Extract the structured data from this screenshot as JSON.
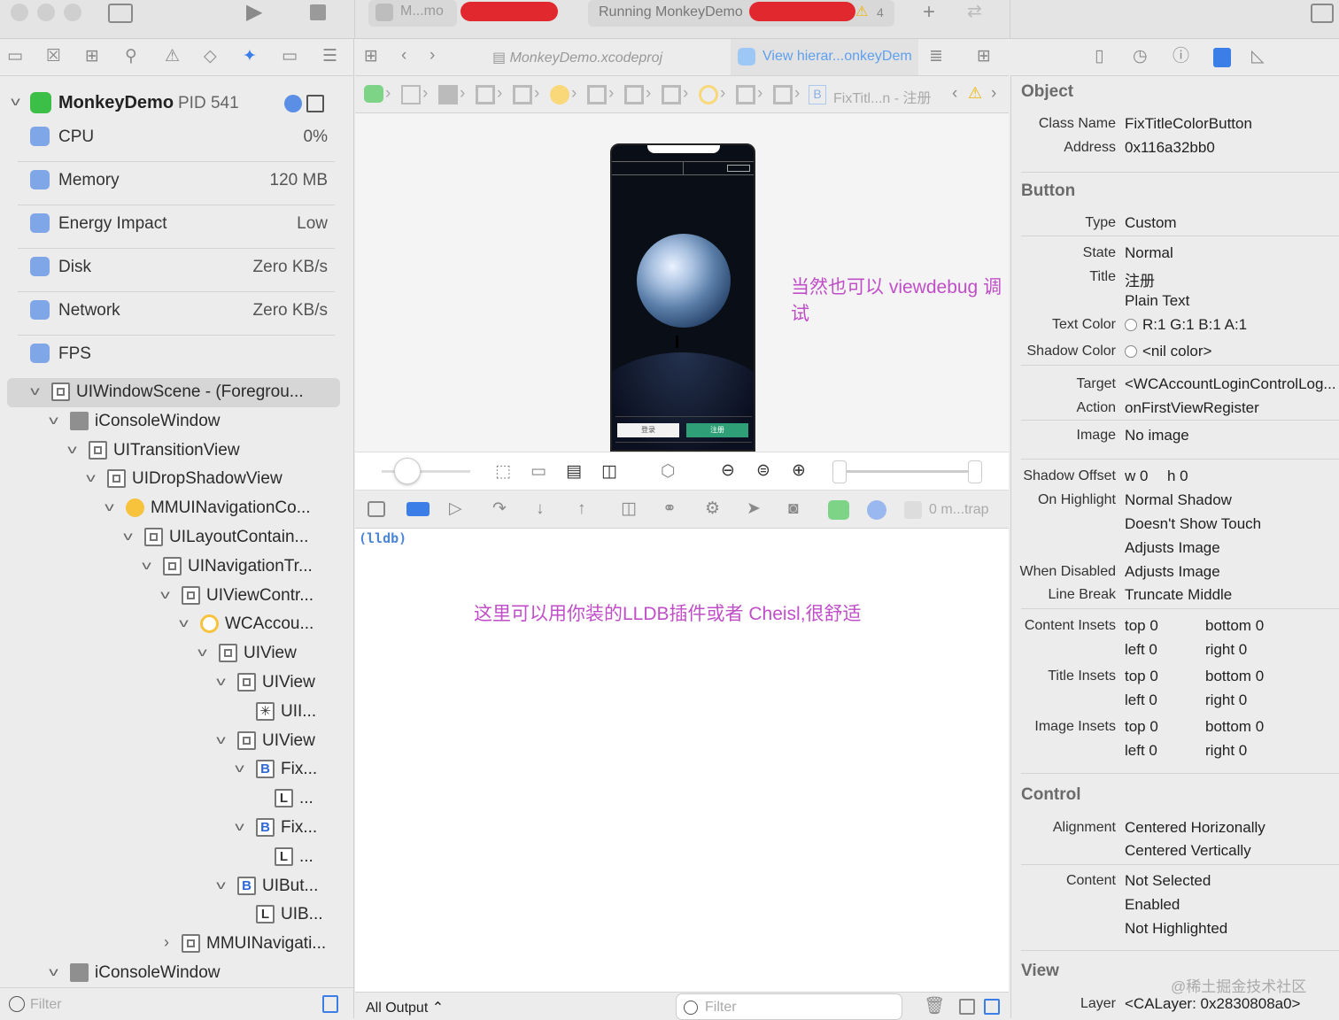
{
  "titlebar": {
    "scheme": "M...mo",
    "status": "Running MonkeyDemo",
    "warnings": "4"
  },
  "editor": {
    "tab1": "MonkeyDemo.xcodeproj",
    "tab2": "View hierar...onkeyDem",
    "jump_last": "FixTitl...n - 注册"
  },
  "debug_nav": {
    "app": {
      "name": "MonkeyDemo",
      "pid": "PID 541"
    },
    "gauges": [
      {
        "name": "CPU",
        "value": "0%",
        "icon": "cpu-icon",
        "color": "#5b8fe6"
      },
      {
        "name": "Memory",
        "value": "120 MB",
        "icon": "memory-icon",
        "color": "#5b8fe6"
      },
      {
        "name": "Energy Impact",
        "value": "Low",
        "icon": "bolt-icon",
        "color": "#5b8fe6"
      },
      {
        "name": "Disk",
        "value": "Zero KB/s",
        "icon": "disk-icon",
        "color": "#5b8fe6"
      },
      {
        "name": "Network",
        "value": "Zero KB/s",
        "icon": "globe-icon",
        "color": "#5b8fe6"
      },
      {
        "name": "FPS",
        "value": "",
        "icon": "fps-icon",
        "color": "#5b8fe6"
      }
    ],
    "tree": [
      {
        "label": "UIWindowScene - (Foregrou...",
        "depth": 0,
        "chev": "v",
        "icon": "inner",
        "selected": true
      },
      {
        "label": "iConsoleWindow",
        "depth": 1,
        "chev": "v",
        "icon": "filled"
      },
      {
        "label": "UITransitionView",
        "depth": 2,
        "chev": "v",
        "icon": "inner"
      },
      {
        "label": "UIDropShadowView",
        "depth": 3,
        "chev": "v",
        "icon": "inner"
      },
      {
        "label": "MMUINavigationCo...",
        "depth": 4,
        "chev": "v",
        "icon": "orng"
      },
      {
        "label": "UILayoutContain...",
        "depth": 5,
        "chev": "v",
        "icon": "inner"
      },
      {
        "label": "UINavigationTr...",
        "depth": 6,
        "chev": "v",
        "icon": "inner"
      },
      {
        "label": "UIViewContr...",
        "depth": 7,
        "chev": "v",
        "icon": "inner"
      },
      {
        "label": "WCAccou...",
        "depth": 8,
        "chev": "v",
        "icon": "orngring"
      },
      {
        "label": "UIView",
        "depth": 9,
        "chev": "v",
        "icon": "inner"
      },
      {
        "label": "UIView",
        "depth": 10,
        "chev": "v",
        "icon": "inner"
      },
      {
        "label": "UII...",
        "depth": 11,
        "chev": "",
        "icon": "img"
      },
      {
        "label": "UIView",
        "depth": 10,
        "chev": "v",
        "icon": "inner"
      },
      {
        "label": "Fix...",
        "depth": 11,
        "chev": "v",
        "icon": "B"
      },
      {
        "label": "...",
        "depth": 12,
        "chev": "",
        "icon": "L"
      },
      {
        "label": "Fix...",
        "depth": 11,
        "chev": "v",
        "icon": "B"
      },
      {
        "label": "...",
        "depth": 12,
        "chev": "",
        "icon": "L"
      },
      {
        "label": "UIBut...",
        "depth": 10,
        "chev": "v",
        "icon": "B"
      },
      {
        "label": "UIB...",
        "depth": 11,
        "chev": "",
        "icon": "L"
      },
      {
        "label": "MMUINavigati...",
        "depth": 7,
        "chev": ">",
        "icon": "inner"
      },
      {
        "label": "iConsoleWindow",
        "depth": 1,
        "chev": "v",
        "icon": "filled"
      }
    ],
    "filter_placeholder": "Filter"
  },
  "canvas": {
    "annotation": "当然也可以 viewdebug 调试",
    "phone_btn_left": "登录",
    "phone_btn_right": "注册"
  },
  "console": {
    "prompt": "(lldb)",
    "annotation": "这里可以用你装的LLDB插件或者 Cheisl,很舒适",
    "output_selector": "All Output ⌃",
    "filter_placeholder": "Filter",
    "stop_label": "0 m...trap"
  },
  "inspector": {
    "object": {
      "title": "Object",
      "class_name_k": "Class Name",
      "class_name": "FixTitleColorButton",
      "address_k": "Address",
      "address": "0x116a32bb0"
    },
    "button": {
      "title": "Button",
      "type_k": "Type",
      "type": "Custom",
      "state_k": "State",
      "state": "Normal",
      "title_k": "Title",
      "title_v": "注册",
      "title_kind": "Plain Text",
      "text_color_k": "Text Color",
      "text_color": "R:1 G:1 B:1 A:1",
      "shadow_color_k": "Shadow Color",
      "shadow_color": "<nil color>",
      "target_k": "Target",
      "target": "<WCAccountLoginControlLog...",
      "action_k": "Action",
      "action": "onFirstViewRegister",
      "image_k": "Image",
      "image": "No image",
      "shadow_offset_k": "Shadow Offset",
      "shadow_w": "w  0",
      "shadow_h": "h  0",
      "on_highlight_k": "On Highlight",
      "on_highlight": "Normal Shadow",
      "touch": "Doesn't Show Touch",
      "adjusts1": "Adjusts Image",
      "when_disabled_k": "When Disabled",
      "adjusts2": "Adjusts Image",
      "line_break_k": "Line Break",
      "line_break": "Truncate Middle",
      "content_insets_k": "Content Insets",
      "title_insets_k": "Title Insets",
      "image_insets_k": "Image Insets",
      "top": "top  0",
      "bottom": "bottom  0",
      "left": "left  0",
      "right": "right  0"
    },
    "control": {
      "title": "Control",
      "alignment_k": "Alignment",
      "align_h": "Centered Horizonally",
      "align_v": "Centered Vertically",
      "content_k": "Content",
      "c1": "Not Selected",
      "c2": "Enabled",
      "c3": "Not Highlighted"
    },
    "view": {
      "title": "View",
      "layer_k": "Layer",
      "layer": "<CALayer: 0x2830808a0>"
    }
  },
  "watermark": "@稀土掘金技术社区"
}
